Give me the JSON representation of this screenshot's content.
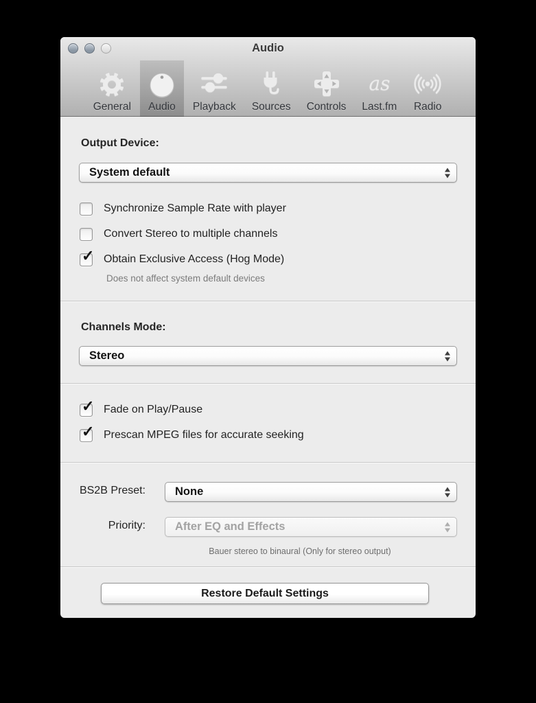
{
  "window": {
    "title": "Audio"
  },
  "toolbar": {
    "items": [
      {
        "label": "General",
        "icon": "gear-icon",
        "selected": false
      },
      {
        "label": "Audio",
        "icon": "knob-icon",
        "selected": true
      },
      {
        "label": "Playback",
        "icon": "sliders-icon",
        "selected": false
      },
      {
        "label": "Sources",
        "icon": "plug-icon",
        "selected": false
      },
      {
        "label": "Controls",
        "icon": "dpad-icon",
        "selected": false
      },
      {
        "label": "Last.fm",
        "icon": "lastfm-icon",
        "selected": false
      },
      {
        "label": "Radio",
        "icon": "broadcast-icon",
        "selected": false
      }
    ]
  },
  "output_section": {
    "label": "Output Device:",
    "device_select": {
      "value": "System default"
    },
    "checkboxes": [
      {
        "label": "Synchronize Sample Rate with player",
        "checked": false,
        "mark": ""
      },
      {
        "label": "Convert Stereo to multiple channels",
        "checked": false,
        "mark": ""
      },
      {
        "label": "Obtain Exclusive Access (Hog Mode)",
        "checked": true,
        "mark": "✓"
      }
    ],
    "note": "Does not affect system default devices"
  },
  "channels_section": {
    "label": "Channels Mode:",
    "mode_select": {
      "value": "Stereo"
    }
  },
  "playback_section": {
    "checkboxes": [
      {
        "label": "Fade on Play/Pause",
        "checked": true,
        "mark": "✓"
      },
      {
        "label": "Prescan MPEG files for accurate seeking",
        "checked": true,
        "mark": "✓"
      }
    ]
  },
  "bs2b_section": {
    "preset_label": "BS2B Preset:",
    "preset_select": {
      "value": "None"
    },
    "priority_label": "Priority:",
    "priority_select": {
      "value": "After EQ and Effects",
      "disabled": true
    },
    "caption": "Bauer stereo to binaural (Only for stereo output)"
  },
  "footer": {
    "restore_button": "Restore Default Settings"
  },
  "colors": {
    "content_bg": "#ececec",
    "header_border": "#6f6f6f",
    "graphite_light": "#8a97a4"
  }
}
